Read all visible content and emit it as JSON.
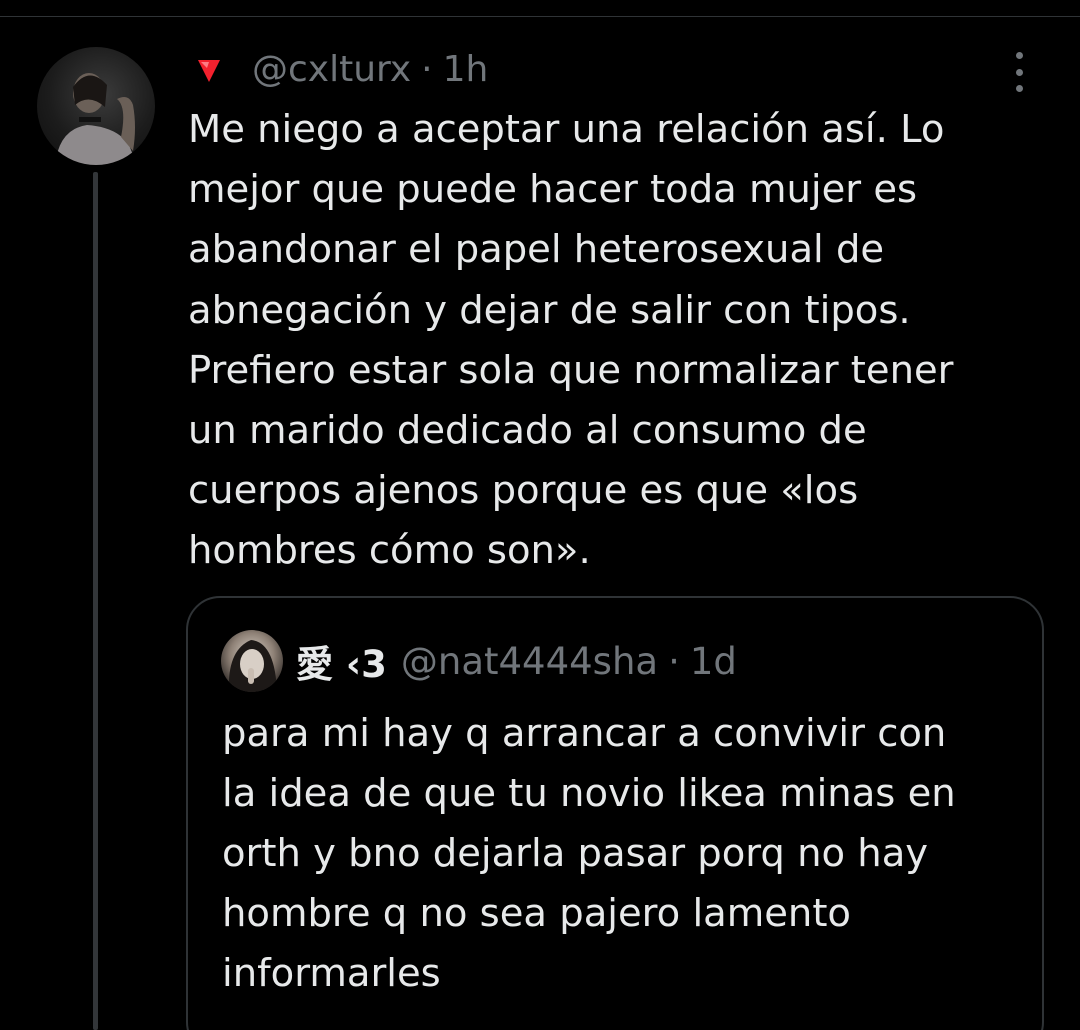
{
  "tweet": {
    "handle": "@cxlturx",
    "separator": "·",
    "time": "1h",
    "text": "Me niego a aceptar una relación así. Lo\nmejor que puede hacer toda mujer es\nabandonar el papel heterosexual de\nabnegación y dejar de salir con tipos.\nPrefiero estar sola que normalizar tener\nun marido dedicado al consumo de\ncuerpos ajenos porque es que «los\nhombres cómo son».",
    "flag_icon": "red-triangle-down-icon",
    "more_icon": "vertical-ellipsis-icon"
  },
  "quote": {
    "display_name": "愛 ‹3",
    "handle": "@nat4444sha",
    "separator": "·",
    "time": "1d",
    "text": "para mi hay q arrancar a convivir con\nla idea de que tu novio likea minas en\north y bno dejarla pasar porq no hay\nhombre q no sea pajero lamento\ninformarles"
  },
  "colors": {
    "background": "#000000",
    "text_primary": "#e7e9ea",
    "text_secondary": "#71767b",
    "border": "#2f3336",
    "flag_red": "#f4212e"
  }
}
